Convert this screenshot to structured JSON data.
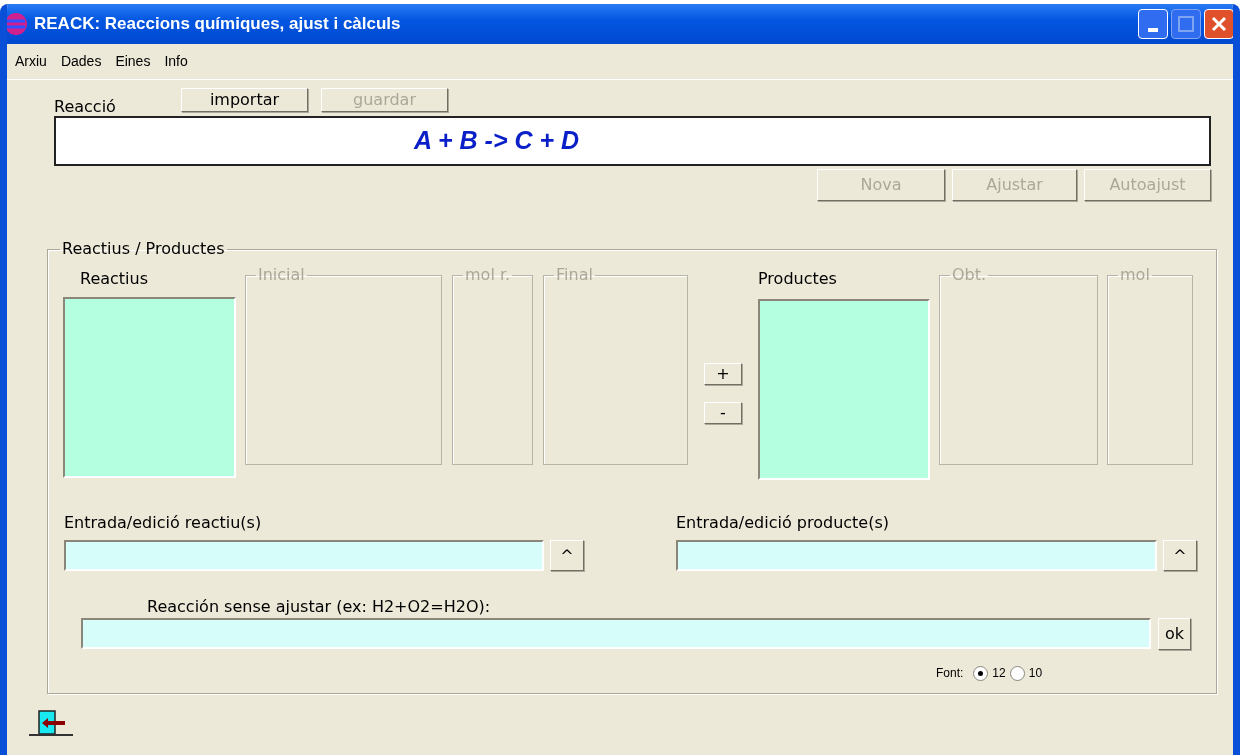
{
  "window": {
    "title": "REACK: Reaccions químiques, ajust i càlculs"
  },
  "menu": [
    "Arxiu",
    "Dades",
    "Eines",
    "Info"
  ],
  "reaction": {
    "label": "Reacció",
    "buttons": [
      {
        "label": "importar",
        "disabled": false
      },
      {
        "label": "guardar",
        "disabled": true
      }
    ],
    "equation": "A + B -> C + D",
    "actions": [
      {
        "label": "Nova",
        "disabled": true
      },
      {
        "label": "Ajustar",
        "disabled": true
      },
      {
        "label": "Autoajust",
        "disabled": true
      }
    ]
  },
  "group": {
    "title": "Reactius / Productes",
    "reactants_label": "Reactius",
    "reactant_columns": [
      {
        "title": "Inicial",
        "disabled": true
      },
      {
        "title": "mol r.",
        "disabled": true
      },
      {
        "title": "Final",
        "disabled": true
      }
    ],
    "add_button": "+",
    "remove_button": "-",
    "products_label": "Productes",
    "product_columns": [
      {
        "title": "Obt.",
        "disabled": true
      },
      {
        "title": "mol",
        "disabled": true
      }
    ],
    "reactant_entry": {
      "label": "Entrada/edició reactiu(s)",
      "button": "^"
    },
    "product_entry": {
      "label": "Entrada/edició producte(s)",
      "button": "^"
    },
    "unbalanced": {
      "label": "Reacción sense ajustar (ex: H2+O2=H2O):",
      "button": "ok"
    },
    "font": {
      "label": "Font:",
      "options": [
        {
          "label": "12",
          "selected": true
        },
        {
          "label": "10",
          "selected": false
        }
      ]
    }
  }
}
